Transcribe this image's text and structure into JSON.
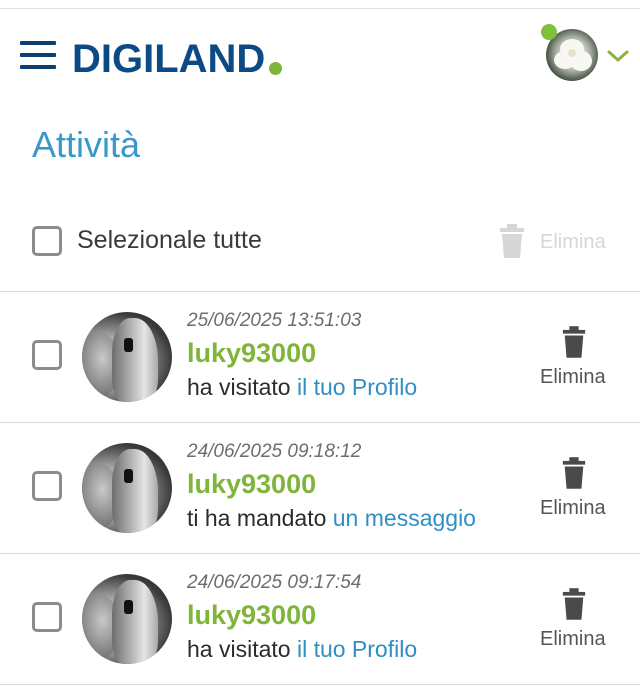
{
  "header": {
    "logo_text": "DIGILAND",
    "menu_icon": "hamburger-menu-icon",
    "avatar_icon": "user-avatar",
    "dropdown_icon": "chevron-down-icon",
    "brand_color": "#0c4a86",
    "accent_color": "#7fb539"
  },
  "page": {
    "title": "Attività"
  },
  "bulk": {
    "select_all_label": "Selezionale tutte",
    "delete_label": "Elimina",
    "delete_icon": "trash-icon"
  },
  "activities": [
    {
      "timestamp": "25/06/2025 13:51:03",
      "username": "luky93000",
      "action_text": "ha visitato ",
      "action_link": "il tuo Profilo",
      "delete_label": "Elimina"
    },
    {
      "timestamp": "24/06/2025 09:18:12",
      "username": "luky93000",
      "action_text": "ti ha mandato ",
      "action_link": "un messaggio",
      "delete_label": "Elimina"
    },
    {
      "timestamp": "24/06/2025 09:17:54",
      "username": "luky93000",
      "action_text": "ha visitato ",
      "action_link": "il tuo Profilo",
      "delete_label": "Elimina"
    }
  ]
}
